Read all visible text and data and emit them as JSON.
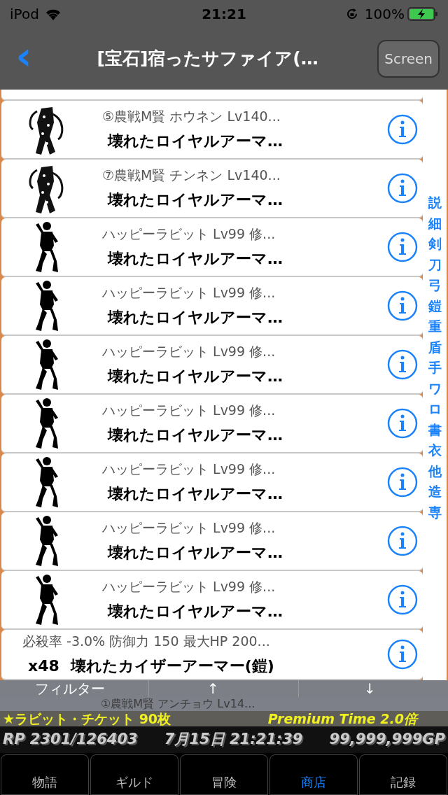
{
  "status_bar": {
    "carrier": "iPod",
    "time": "21:21",
    "battery": "100%"
  },
  "nav": {
    "back": "‹",
    "title": "[宝石]宿ったサファイア(…",
    "button": "Screen"
  },
  "rows": [
    {
      "kind": "monster",
      "subtitle": "⑤農戦M賢 ホウネン Lv140...",
      "title": "壊れたロイヤルアーマ…"
    },
    {
      "kind": "monster",
      "subtitle": "⑦農戦M賢 チンネン Lv140...",
      "title": "壊れたロイヤルアーマ…"
    },
    {
      "kind": "rabbit",
      "subtitle": "ハッピーラビット Lv99 修...",
      "title": "壊れたロイヤルアーマ…"
    },
    {
      "kind": "rabbit",
      "subtitle": "ハッピーラビット Lv99 修...",
      "title": "壊れたロイヤルアーマ…"
    },
    {
      "kind": "rabbit",
      "subtitle": "ハッピーラビット Lv99 修...",
      "title": "壊れたロイヤルアーマ…"
    },
    {
      "kind": "rabbit",
      "subtitle": "ハッピーラビット Lv99 修...",
      "title": "壊れたロイヤルアーマ…"
    },
    {
      "kind": "rabbit",
      "subtitle": "ハッピーラビット Lv99 修...",
      "title": "壊れたロイヤルアーマ…"
    },
    {
      "kind": "rabbit",
      "subtitle": "ハッピーラビット Lv99 修...",
      "title": "壊れたロイヤルアーマ…"
    },
    {
      "kind": "rabbit",
      "subtitle": "ハッピーラビット Lv99 修...",
      "title": "壊れたロイヤルアーマ…"
    },
    {
      "kind": "item",
      "subtitle": "必殺率 -3.0% 防御力 150 最大HP 200...",
      "count": "x48",
      "title": "壊れたカイザーアーマー(鎧)"
    },
    {
      "kind": "monster",
      "subtitle": "①農戦M賢 アンチョウ Lv14..."
    }
  ],
  "index": [
    "説",
    "細",
    "剣",
    "刀",
    "弓",
    "鎧",
    "重",
    "盾",
    "手",
    "ワ",
    "ロ",
    "書",
    "衣",
    "他",
    "造",
    "専"
  ],
  "filter": {
    "label": "フィルター",
    "up": "↑",
    "down": "↓"
  },
  "premium": {
    "ticket": "★ラビット・チケット 90枚",
    "time": "Premium Time 2.0倍"
  },
  "info": {
    "rp": "RP 2301/126403",
    "date": "7月15日 21:21:39",
    "gp": "99,999,999GP"
  },
  "tabs": [
    {
      "label": "物語",
      "selected": false
    },
    {
      "label": "ギルド",
      "selected": false
    },
    {
      "label": "冒険",
      "selected": false
    },
    {
      "label": "商店",
      "selected": true
    },
    {
      "label": "記録",
      "selected": false
    }
  ]
}
